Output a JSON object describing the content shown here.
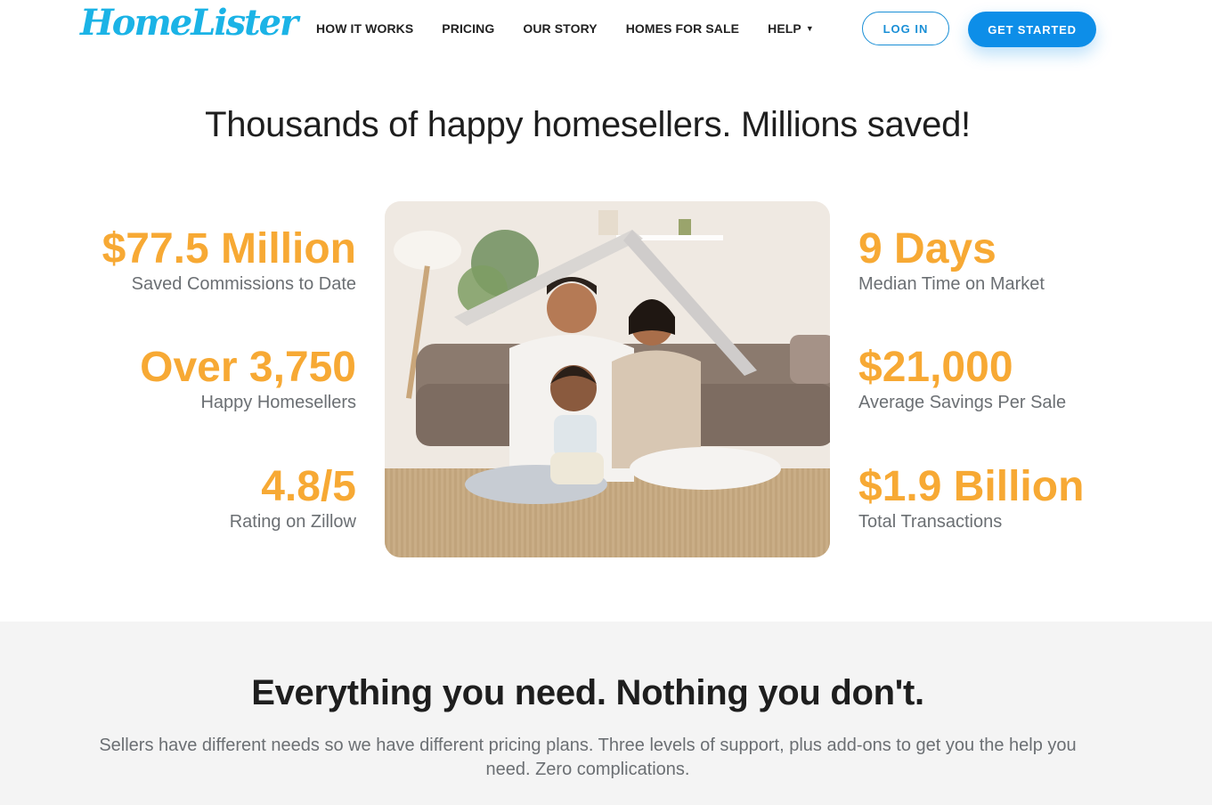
{
  "header": {
    "logo_text": "HomeLister",
    "nav": [
      {
        "label": "HOW IT WORKS"
      },
      {
        "label": "PRICING"
      },
      {
        "label": "OUR STORY"
      },
      {
        "label": "HOMES FOR SALE"
      },
      {
        "label": "HELP"
      }
    ],
    "login_label": "LOG IN",
    "cta_label": "GET STARTED"
  },
  "hero": {
    "title": "Thousands of happy homesellers. Millions saved!"
  },
  "stats_left": [
    {
      "value": "$77.5 Million",
      "label": "Saved Commissions to Date"
    },
    {
      "value": "Over 3,750",
      "label": "Happy Homesellers"
    },
    {
      "value": "4.8/5",
      "label": "Rating on Zillow"
    }
  ],
  "stats_right": [
    {
      "value": "9 Days",
      "label": "Median Time on Market"
    },
    {
      "value": "$21,000",
      "label": "Average Savings Per Sale"
    },
    {
      "value": "$1.9 Billion",
      "label": "Total Transactions"
    }
  ],
  "section2": {
    "title": "Everything you need. Nothing you don't.",
    "subtitle": "Sellers have different needs so we have different pricing plans. Three levels of support, plus add-ons to get you the help you need. Zero complications."
  },
  "colors": {
    "brand_blue": "#1bb3e6",
    "button_blue": "#0d8ee8",
    "stat_orange": "#f7a934"
  }
}
